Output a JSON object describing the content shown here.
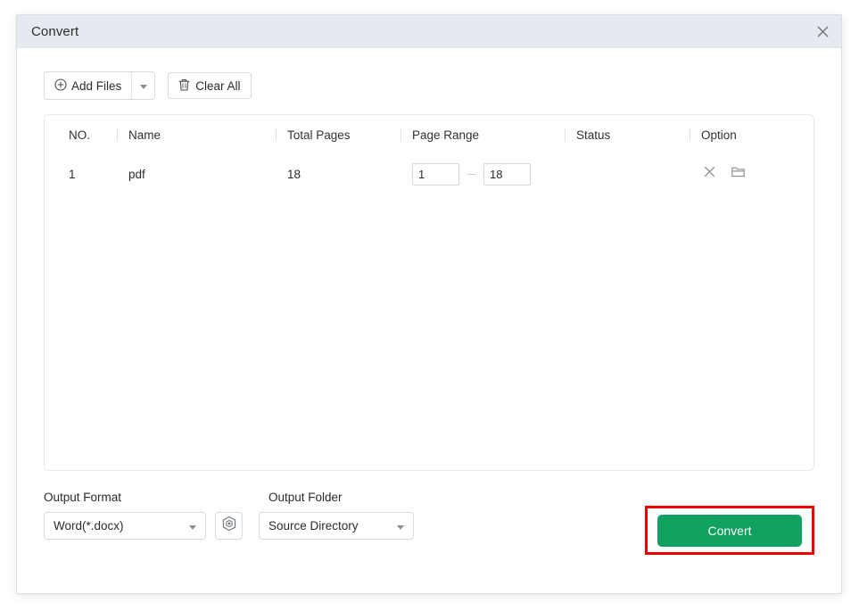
{
  "window": {
    "title": "Convert",
    "close_label": "×"
  },
  "toolbar": {
    "add_files_label": "Add Files",
    "add_files_icon": "circle-plus-icon",
    "add_files_dropdown_icon": "chevron-down-icon",
    "clear_all_label": "Clear All",
    "clear_all_icon": "trash-icon"
  },
  "table": {
    "columns": [
      "NO.",
      "Name",
      "Total Pages",
      "Page Range",
      "Status",
      "Option"
    ],
    "rows": [
      {
        "no": "1",
        "name": "pdf",
        "total_pages": "18",
        "page_range_start": "1",
        "page_range_end": "18",
        "range_separator": "–",
        "status": "",
        "option_remove_icon": "close-icon",
        "option_folder_icon": "folder-icon"
      }
    ]
  },
  "footer": {
    "output_format_label": "Output Format",
    "output_folder_label": "Output Folder",
    "output_format_value": "Word(*.docx)",
    "output_folder_value": "Source Directory",
    "dropdown_icon": "chevron-down-icon",
    "settings_icon": "gear-hex-icon",
    "convert_label": "Convert"
  },
  "colors": {
    "titlebar_bg": "#e6e9f0",
    "accent_green": "#10a05f",
    "annotation_red": "#f00000",
    "panel_border": "#e6e8ec",
    "text": "#2b2b2b"
  }
}
